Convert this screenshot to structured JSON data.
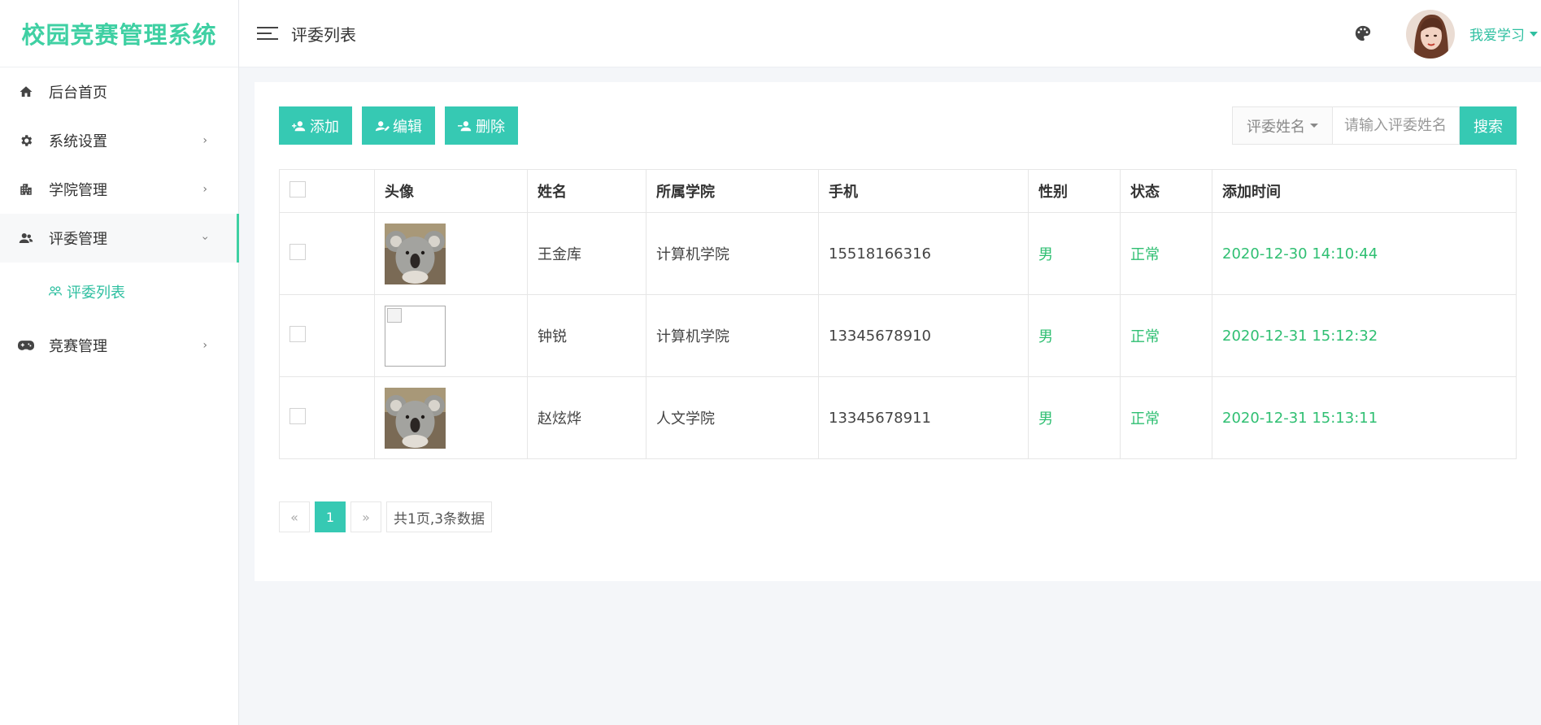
{
  "brand": "校园竞赛管理系统",
  "header": {
    "title": "评委列表",
    "user_name": "我爱学习"
  },
  "sidebar": {
    "items": [
      {
        "label": "后台首页",
        "icon": "home-icon"
      },
      {
        "label": "系统设置",
        "icon": "gear-icon"
      },
      {
        "label": "学院管理",
        "icon": "building-icon"
      },
      {
        "label": "评委管理",
        "icon": "users-icon"
      },
      {
        "label": "竞赛管理",
        "icon": "gamepad-icon"
      }
    ],
    "sub_item": {
      "label": "评委列表",
      "icon": "group-icon"
    }
  },
  "toolbar": {
    "add": "添加",
    "edit": "编辑",
    "delete": "删除"
  },
  "search": {
    "field": "评委姓名",
    "placeholder": "请输入评委姓名",
    "button": "搜索"
  },
  "table": {
    "headers": [
      "头像",
      "姓名",
      "所属学院",
      "手机",
      "性别",
      "状态",
      "添加时间"
    ],
    "rows": [
      {
        "avatar": "koala",
        "name": "王金库",
        "college": "计算机学院",
        "phone": "15518166316",
        "gender": "男",
        "status": "正常",
        "time": "2020-12-30 14:10:44"
      },
      {
        "avatar": "broken",
        "name": "钟锐",
        "college": "计算机学院",
        "phone": "13345678910",
        "gender": "男",
        "status": "正常",
        "time": "2020-12-31 15:12:32"
      },
      {
        "avatar": "koala",
        "name": "赵炫烨",
        "college": "人文学院",
        "phone": "13345678911",
        "gender": "男",
        "status": "正常",
        "time": "2020-12-31 15:13:11"
      }
    ]
  },
  "pagination": {
    "prev": "«",
    "current": "1",
    "next": "»",
    "info": "共1页,3条数据"
  },
  "colors": {
    "accent": "#36c9b3",
    "brand": "#3fd0a3",
    "status_green": "#2fbf72"
  }
}
